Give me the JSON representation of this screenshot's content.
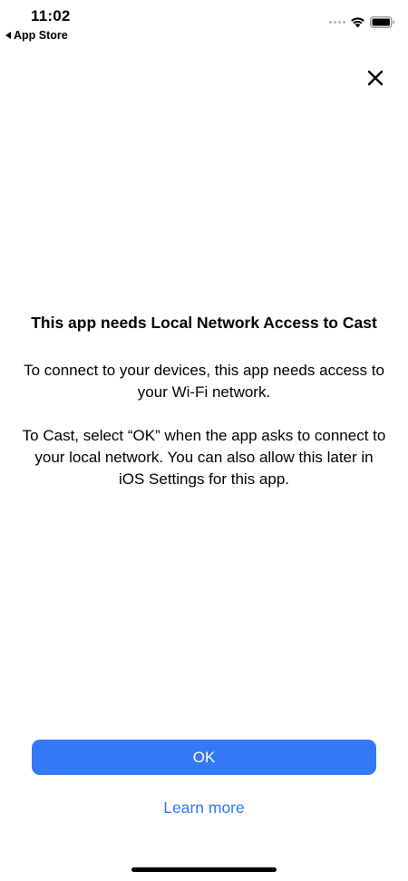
{
  "status_bar": {
    "time": "11:02",
    "back_label": "App Store",
    "icons": [
      "cellular-signal-icon",
      "wifi-icon",
      "battery-icon"
    ]
  },
  "close_icon": "close-icon",
  "dialog": {
    "title": "This app needs Local Network Access to Cast",
    "paragraph_1": "To connect to your devices, this app needs access to your Wi-Fi network.",
    "paragraph_2": "To Cast, select “OK” when the app asks to connect to your local network. You can also allow this later in iOS Settings for this app.",
    "ok_label": "OK",
    "learn_more_label": "Learn more"
  },
  "colors": {
    "accent": "#3478f6",
    "text": "#000000",
    "background": "#ffffff"
  }
}
